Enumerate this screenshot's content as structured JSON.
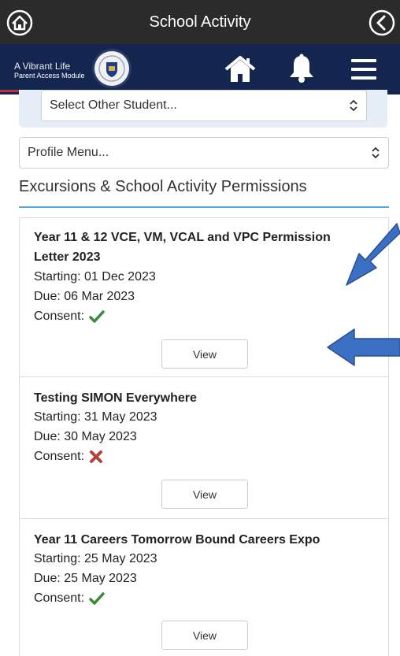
{
  "header": {
    "title": "School Activity"
  },
  "brand": {
    "tagline": "A Vibrant Life",
    "module": "Parent Access Module"
  },
  "student_select": {
    "value": "Select Other Student..."
  },
  "profile_select": {
    "value": "Profile Menu..."
  },
  "section": {
    "title": "Excursions & School Activity Permissions"
  },
  "activities": [
    {
      "name": "Year 11 & 12 VCE, VM, VCAL and VPC Permission Letter 2023",
      "starting": "Starting: 01 Dec 2023",
      "due": "Due: 06 Mar 2023",
      "consent_label": "Consent:",
      "consent_status": "given",
      "view_label": "View"
    },
    {
      "name": "Testing SIMON Everywhere",
      "starting": "Starting: 31 May 2023",
      "due": "Due: 30 May 2023",
      "consent_label": "Consent:",
      "consent_status": "not given",
      "view_label": "View"
    },
    {
      "name": "Year 11 Careers Tomorrow Bound Careers Expo",
      "starting": "Starting: 25 May 2023",
      "due": "Due: 25 May 2023",
      "consent_label": "Consent:",
      "consent_status": "given",
      "view_label": "View"
    }
  ],
  "icons": {
    "header_left": "home-icon",
    "header_right": "back-icon",
    "nav": [
      "home-icon",
      "bell-icon",
      "hamburger-menu-icon"
    ],
    "consent_given": "checkmark-icon",
    "consent_denied": "cross-icon",
    "annotation": "arrow-icon"
  },
  "colors": {
    "top_bar": "#2b2b2b",
    "nav_bar": "#14264f",
    "accent_line": "#58a6d8",
    "check": "#3b8a3e",
    "cross": "#b0443a",
    "annotation_arrow": "#3a6fc4"
  }
}
